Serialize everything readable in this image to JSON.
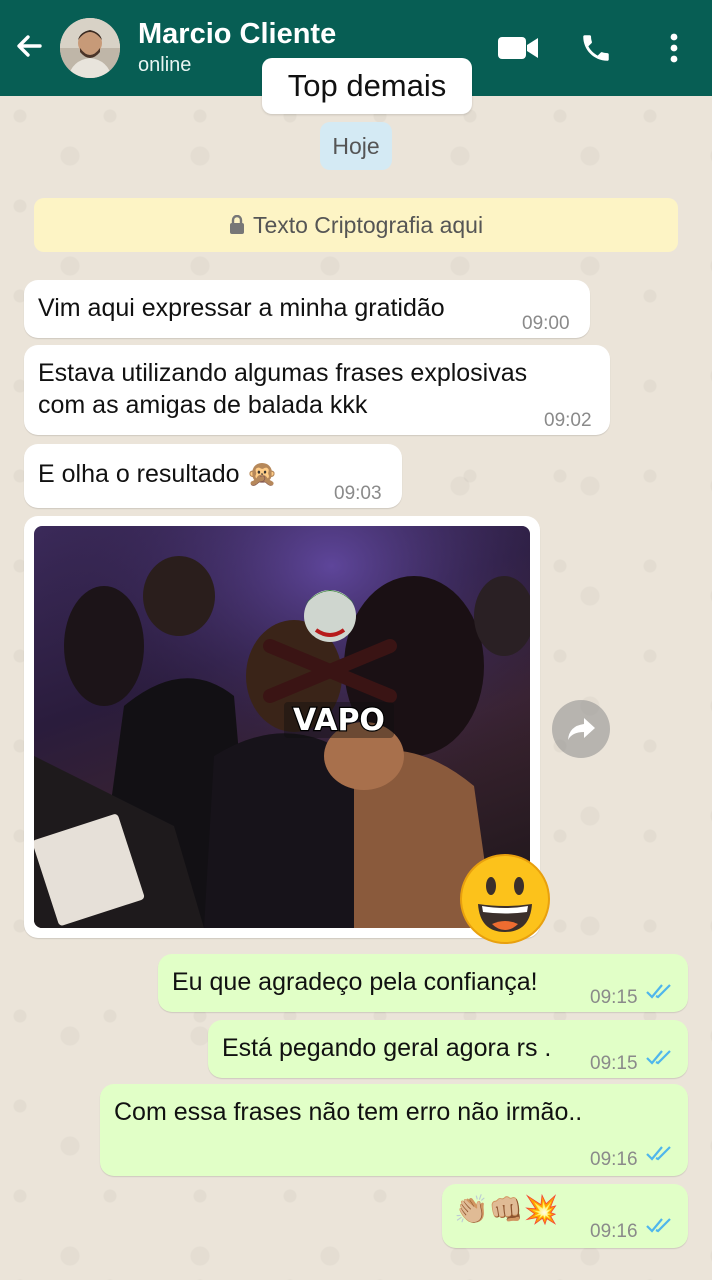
{
  "header": {
    "contact_name": "Marcio Cliente",
    "status": "online",
    "icons": [
      "back-arrow-icon",
      "video-call-icon",
      "phone-call-icon",
      "more-vertical-icon"
    ],
    "color": "#075e54"
  },
  "tooltip": "Top demais",
  "date_chip": "Hoje",
  "encryption_notice": "Texto Criptografia aqui",
  "incoming": [
    {
      "text": "Vim aqui expressar a minha gratidão",
      "time": "09:00"
    },
    {
      "line1": "Estava utilizando algumas frases explosivas",
      "line2": "com as amigas de balada kkk",
      "time": "09:02"
    },
    {
      "text": "E olha o resultado 🙊",
      "time": "09:03"
    }
  ],
  "image_message": {
    "sticker_text": "VAPO",
    "reaction_emoji": "grinning-face-emoji"
  },
  "outgoing": [
    {
      "text": "Eu que agradeço pela confiança!",
      "time": "09:15"
    },
    {
      "text": "Está pegando geral agora rs .",
      "time": "09:15"
    },
    {
      "text": "Com essa frases não tem erro não irmão..",
      "time": "09:16"
    },
    {
      "text": "👏🏼👊🏼💥",
      "time": "09:16"
    }
  ],
  "colors": {
    "outgoing_bubble": "#e1ffc7",
    "incoming_bubble": "#ffffff",
    "read_ticks": "#4fb6ec",
    "encryption_bg": "#fdf4c5",
    "date_chip_bg": "#d4eaf4"
  }
}
